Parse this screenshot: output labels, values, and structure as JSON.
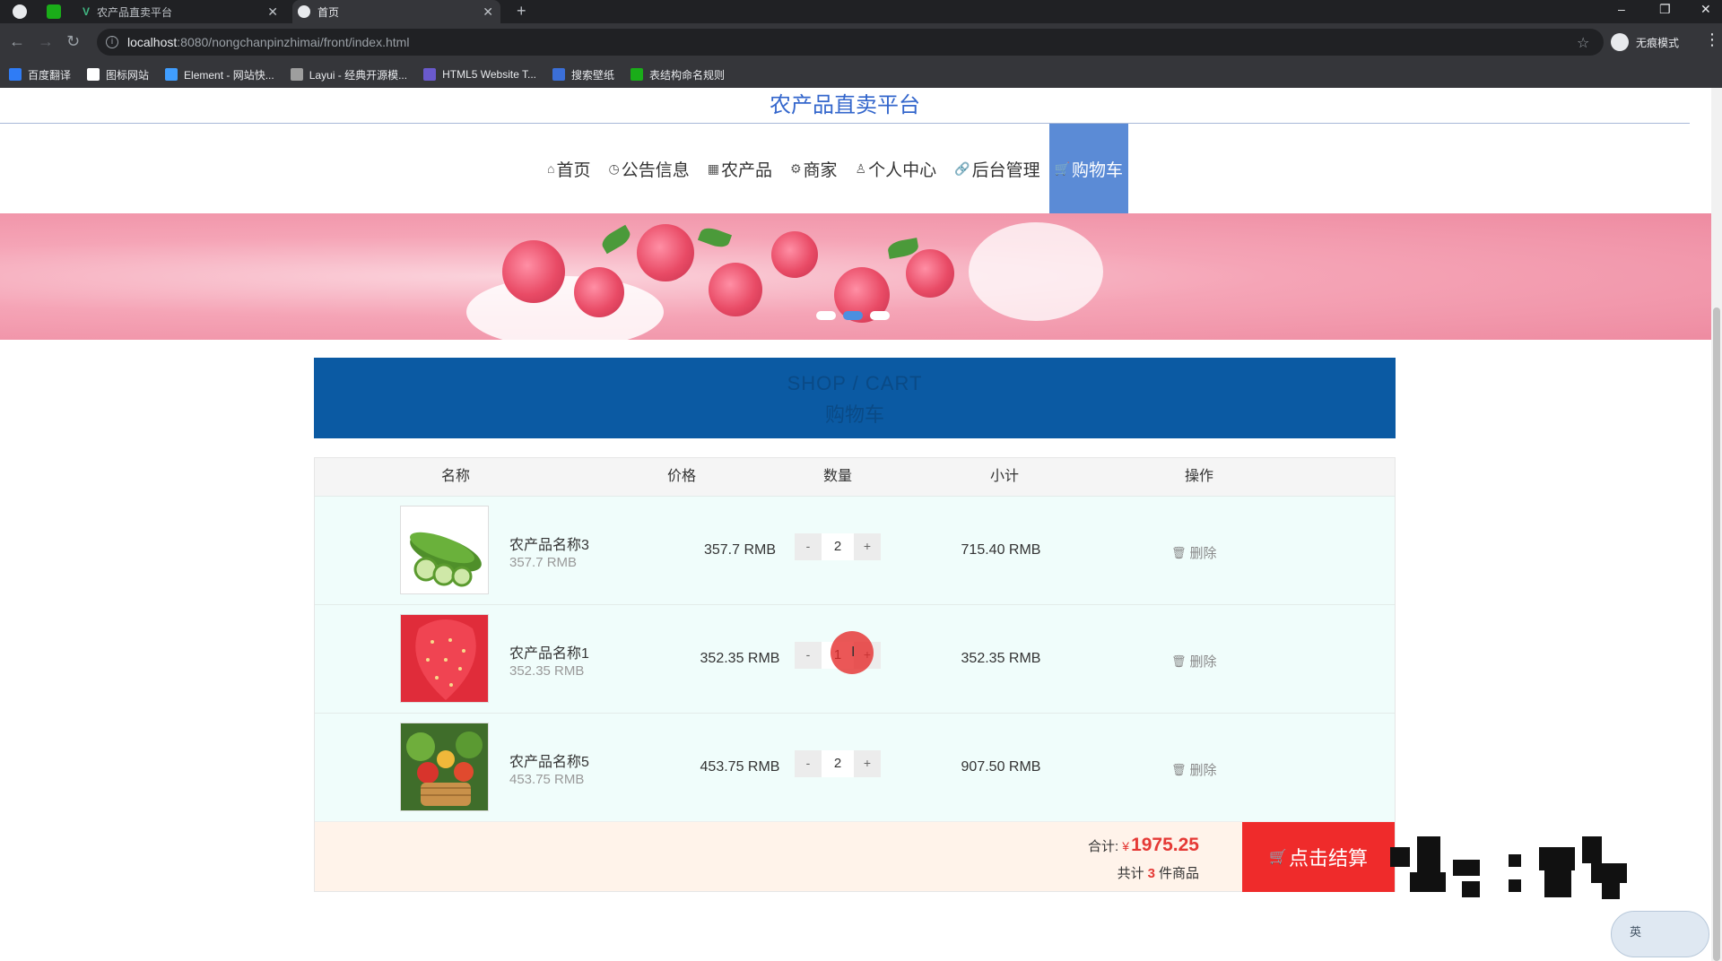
{
  "browser": {
    "tabs": [
      {
        "title": "农产品直卖平台"
      },
      {
        "title": "首页"
      }
    ],
    "address": {
      "host": "localhost",
      "path": ":8080/nongchanpinzhimai/front/index.html"
    },
    "profile_label": "无痕模式",
    "bookmarks": [
      {
        "label": "百度翻译",
        "color": "#2f7cf6"
      },
      {
        "label": "图标网站",
        "color": "#ffffff"
      },
      {
        "label": "Element - 网站快...",
        "color": "#409eff"
      },
      {
        "label": "Layui - 经典开源模...",
        "color": "#9e9e9e"
      },
      {
        "label": "HTML5 Website T...",
        "color": "#6a5acd"
      },
      {
        "label": "搜索壁纸",
        "color": "#3b6fd8"
      },
      {
        "label": "表结构命名规则",
        "color": "#1aad19"
      }
    ]
  },
  "site": {
    "title": "农产品直卖平台",
    "nav": [
      {
        "icon": "home-icon",
        "glyph": "⌂",
        "label": "首页",
        "active": false
      },
      {
        "icon": "clock-icon",
        "glyph": "◷",
        "label": "公告信息",
        "active": false
      },
      {
        "icon": "grid-icon",
        "glyph": "▦",
        "label": "农产品",
        "active": false
      },
      {
        "icon": "gear-icon",
        "glyph": "⚙",
        "label": "商家",
        "active": false
      },
      {
        "icon": "user-icon",
        "glyph": "♙",
        "label": "个人中心",
        "active": false
      },
      {
        "icon": "link-icon",
        "glyph": "🔗",
        "label": "后台管理",
        "active": false
      },
      {
        "icon": "cart-icon",
        "glyph": "🛒",
        "label": "购物车",
        "active": true
      }
    ]
  },
  "cart": {
    "header_en": "SHOP / CART",
    "header_cn": "购物车",
    "columns": {
      "name": "名称",
      "price": "价格",
      "qty": "数量",
      "subtotal": "小计",
      "action": "操作"
    },
    "items": [
      {
        "name": "农产品名称3",
        "sub_price": "357.7 RMB",
        "price": "357.7 RMB",
        "qty": "2",
        "subtotal": "715.40 RMB",
        "delete_label": "删除",
        "image": "cucumber"
      },
      {
        "name": "农产品名称1",
        "sub_price": "352.35 RMB",
        "price": "352.35 RMB",
        "qty": "1",
        "subtotal": "352.35 RMB",
        "delete_label": "删除",
        "image": "strawberry"
      },
      {
        "name": "农产品名称5",
        "sub_price": "453.75 RMB",
        "price": "453.75 RMB",
        "qty": "2",
        "subtotal": "907.50 RMB",
        "delete_label": "删除",
        "image": "vegetables"
      }
    ],
    "minus": "-",
    "plus": "+",
    "total_label": "合计:",
    "currency": "¥",
    "total": "1975.25",
    "count_prefix": "共计",
    "count": "3",
    "count_suffix": "件商品",
    "checkout_label": "点击结算"
  },
  "ime": {
    "label": "英"
  }
}
